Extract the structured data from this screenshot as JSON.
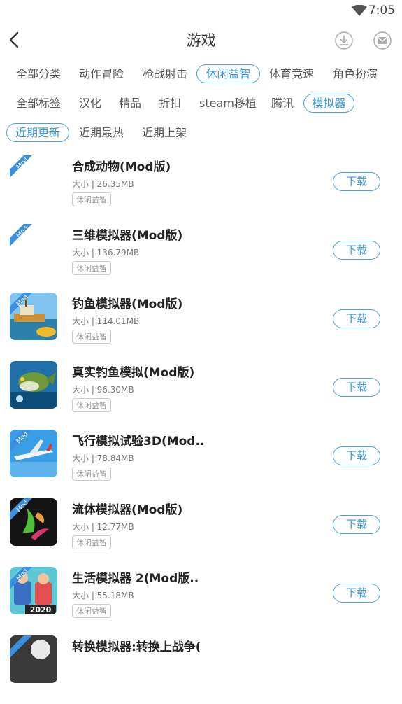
{
  "status": {
    "time": "7:05"
  },
  "header": {
    "title": "游戏"
  },
  "categories": [
    "全部分类",
    "动作冒险",
    "枪战射击",
    "休闲益智",
    "体育竞速",
    "角色扮演"
  ],
  "tags": [
    "全部标签",
    "汉化",
    "精品",
    "折扣",
    "steam移植",
    "腾讯",
    "模拟器"
  ],
  "sorts": [
    "近期更新",
    "近期最热",
    "近期上架"
  ],
  "selected": {
    "category": "休闲益智",
    "tag": "模拟器",
    "sort": "近期更新"
  },
  "icons": {
    "back": "back-arrow-icon",
    "download_manager": "download-circle-icon",
    "messages": "mail-circle-icon",
    "mod_badge": "mod-corner-badge"
  },
  "colors": {
    "accent": "#3b97d6",
    "mod_badge": "#3a8fe0"
  },
  "apps": [
    {
      "name": "合成动物(Mod版)",
      "size": "大小 | 26.35MB",
      "tag": "休闲益智",
      "button": "下载",
      "icon": "blank"
    },
    {
      "name": "三维模拟器(Mod版)",
      "size": "大小 | 136.79MB",
      "tag": "休闲益智",
      "button": "下载",
      "icon": "blank"
    },
    {
      "name": "钓鱼模拟器(Mod版)",
      "size": "大小 | 114.01MB",
      "tag": "休闲益智",
      "button": "下载",
      "icon": "fishing-boat"
    },
    {
      "name": "真实钓鱼模拟(Mod版)",
      "size": "大小 | 96.30MB",
      "tag": "休闲益智",
      "button": "下载",
      "icon": "bass-fish"
    },
    {
      "name": "飞行模拟试验3D(Mod..",
      "size": "大小 | 78.84MB",
      "tag": "休闲益智",
      "button": "下载",
      "icon": "airplane"
    },
    {
      "name": "流体模拟器(Mod版)",
      "size": "大小 | 12.77MB",
      "tag": "休闲益智",
      "button": "下载",
      "icon": "fluid"
    },
    {
      "name": "生活模拟器 2(Mod版..",
      "size": "大小 | 55.18MB",
      "tag": "休闲益智",
      "button": "下载",
      "icon": "life-2020"
    },
    {
      "name": "转换模拟器:转换上战争(",
      "size": "",
      "tag": "",
      "button": "",
      "icon": "partial"
    }
  ],
  "life_icon_year": "2020",
  "mod_label": "Mod"
}
